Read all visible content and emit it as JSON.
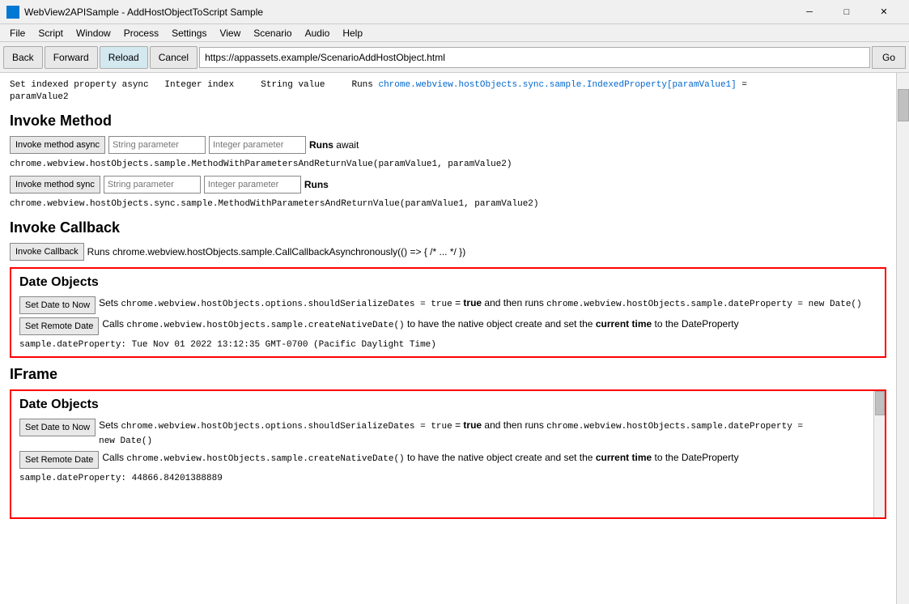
{
  "titleBar": {
    "icon": "webview-icon",
    "title": "WebView2APISample - AddHostObjectToScript Sample",
    "minimizeLabel": "─",
    "maximizeLabel": "□",
    "closeLabel": "✕"
  },
  "menuBar": {
    "items": [
      "File",
      "Script",
      "Window",
      "Process",
      "Settings",
      "View",
      "Scenario",
      "Audio",
      "Help"
    ]
  },
  "navBar": {
    "backLabel": "Back",
    "forwardLabel": "Forward",
    "reloadLabel": "Reload",
    "cancelLabel": "Cancel",
    "url": "https://appassets.example/ScenarioAddHostObject.html",
    "goLabel": "Go"
  },
  "content": {
    "truncatedTop": {
      "line1": "Set indexed property async",
      "param1": "Integer index",
      "param2": "String value",
      "runs": "Runs chrome.webview.hostObjects.sync.sample.IndexedProperty[paramValue1] =",
      "line2": "paramValue2"
    },
    "invokeMethod": {
      "title": "Invoke Method",
      "asyncRow": {
        "btnLabel": "Invoke method async",
        "param1Placeholder": "String parameter",
        "param2Placeholder": "Integer parameter",
        "runsPrefix": "Runs",
        "runsText": "await"
      },
      "asyncCode": "chrome.webview.hostObjects.sample.MethodWithParametersAndReturnValue(paramValue1, paramValue2)",
      "syncRow": {
        "btnLabel": "Invoke method sync",
        "param1Placeholder": "String parameter",
        "param2Placeholder": "Integer parameter",
        "runsPrefix": "Runs",
        "runsText": ""
      },
      "syncCode": "chrome.webview.hostObjects.sync.sample.MethodWithParametersAndReturnValue(paramValue1, paramValue2)"
    },
    "invokeCallback": {
      "title": "Invoke Callback",
      "btnLabel": "Invoke Callback",
      "runsText": "Runs chrome.webview.hostObjects.sample.CallCallbackAsynchronously(() => { /* ... */ })"
    },
    "dateObjects": {
      "title": "Date Objects",
      "setDateBtn": "Set Date to Now",
      "setDateDesc1": "Sets",
      "setDateCode1": "chrome.webview.hostObjects.options.shouldSerializeDates = true",
      "setDateDesc2": "and then runs",
      "setDateCode2": "chrome.webview.hostObjects.sample.dateProperty = new Date()",
      "setRemoteBtn": "Set Remote Date",
      "setRemoteDesc": "Calls",
      "setRemoteCode": "chrome.webview.hostObjects.sample.createNativeDate()",
      "setRemoteDesc2": "to have the native object create and set the",
      "setRemoteDesc3": "current time",
      "setRemoteDesc4": "to the DateProperty",
      "outputLine": "sample.dateProperty: Tue Nov 01 2022 13:12:35 GMT-0700 (Pacific Daylight Time)"
    },
    "iframe": {
      "title": "IFrame",
      "innerBox": {
        "title": "Date Objects",
        "setDateBtn": "Set Date to Now",
        "setDateDesc1": "Sets",
        "setDateCode1": "chrome.webview.hostObjects.options.shouldSerializeDates = true",
        "setDateDesc2": "and then runs",
        "setDateCode2": "chrome.webview.hostObjects.sample.dateProperty =",
        "setDateCode3": "new Date()",
        "setRemoteBtn": "Set Remote Date",
        "setRemoteDesc": "Calls",
        "setRemoteCode": "chrome.webview.hostObjects.sample.createNativeDate()",
        "setRemoteDesc2": "to have the native object create and set the",
        "setRemoteDesc3": "current time",
        "setRemoteDesc4": "to the DateProperty",
        "outputLine": "sample.dateProperty: 44866.84201388889"
      }
    }
  }
}
